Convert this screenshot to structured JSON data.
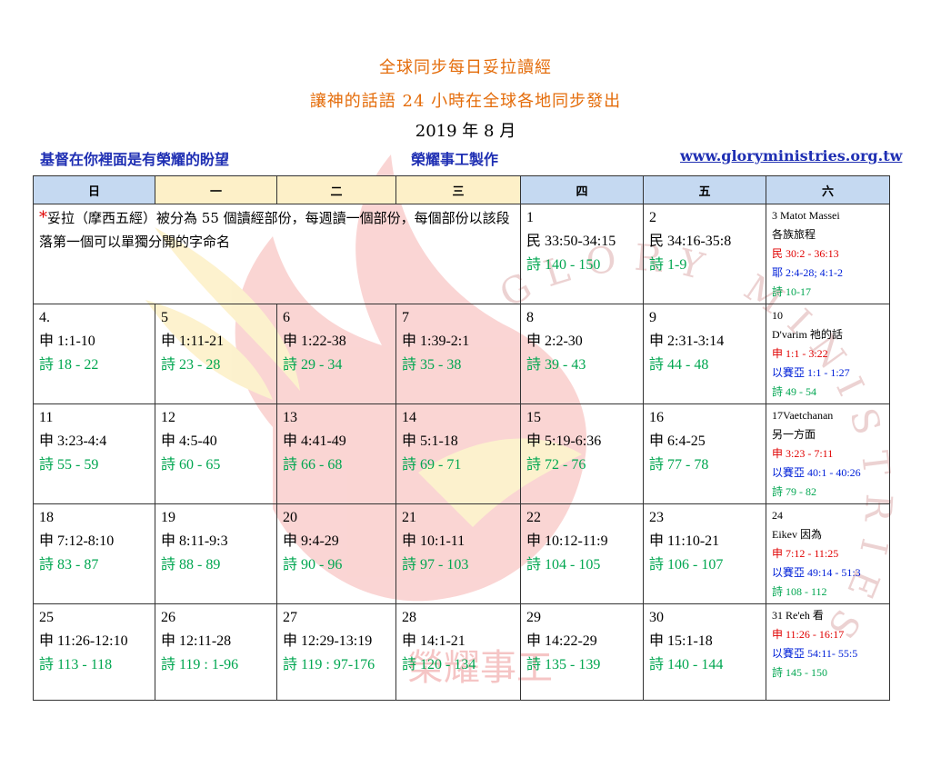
{
  "header": {
    "title": "全球同步每日妥拉讀經",
    "subtitle": "讓神的話語 24 小時在全球各地同步發出",
    "date": "2019 年 8 月",
    "motto": "基督在你裡面是有榮耀的盼望",
    "producer": "榮耀事工製作",
    "website": "www.gloryministries.org.tw"
  },
  "weekdays": [
    "日",
    "一",
    "二",
    "三",
    "四",
    "五",
    "六"
  ],
  "note": {
    "star": "*",
    "text": "妥拉（摩西五經）被分為 55 個讀經部份，每週讀一個部份，每個部份以該段落第一個可以單獨分開的字命名"
  },
  "watermark": {
    "arc_text": "GLORY MINISTRIES",
    "logo_text": "榮耀事工"
  },
  "weeks": [
    {
      "days": [
        {
          "num": "1",
          "reading": "民 33:50-34:15",
          "psalm": "詩  140 - 150"
        },
        {
          "num": "2",
          "reading": "民 34:16-35:8",
          "psalm": "詩  1-9"
        }
      ],
      "sabbath": {
        "line1": "3 Matot Massei",
        "line2": "各族旅程",
        "red": "民 30:2 - 36:13",
        "blue": "耶 2:4-28; 4:1-2",
        "green": "詩  10-17"
      }
    },
    {
      "days": [
        {
          "num": "4.",
          "reading": "申 1:1-10",
          "psalm": "詩  18 - 22"
        },
        {
          "num": "5",
          "reading": "申 1:11-21",
          "psalm": "詩  23 - 28"
        },
        {
          "num": "6",
          "reading": "申 1:22-38",
          "psalm": "詩  29 - 34"
        },
        {
          "num": "7",
          "reading": "申 1:39-2:1",
          "psalm": "詩  35 - 38"
        },
        {
          "num": "8",
          "reading": "申 2:2-30",
          "psalm": "詩  39 - 43"
        },
        {
          "num": "9",
          "reading": "申 2:31-3:14",
          "psalm": "詩  44 - 48"
        }
      ],
      "sabbath": {
        "line1": "10",
        "line2": "D'varim  祂的話",
        "red": "申 1:1 - 3:22",
        "blue": "以賽亞 1:1 - 1:27",
        "green": "詩  49 - 54"
      }
    },
    {
      "days": [
        {
          "num": "11",
          "reading": "申 3:23-4:4",
          "psalm": "詩  55 - 59"
        },
        {
          "num": "12",
          "reading": "申 4:5-40",
          "psalm": "詩  60 - 65"
        },
        {
          "num": "13",
          "reading": "申 4:41-49",
          "psalm": "詩  66 - 68"
        },
        {
          "num": "14",
          "reading": "申 5:1-18",
          "psalm": "詩  69 - 71"
        },
        {
          "num": "15",
          "reading": "申 5:19-6:36",
          "psalm": "詩  72 - 76"
        },
        {
          "num": "16",
          "reading": "申 6:4-25",
          "psalm": "詩  77 - 78"
        }
      ],
      "sabbath": {
        "line1": "17Vaetchanan",
        "line2": "另一方面",
        "red": "申 3:23 - 7:11",
        "blue": "以賽亞 40:1 - 40:26",
        "green": "詩  79 - 82"
      }
    },
    {
      "days": [
        {
          "num": "18",
          "reading": "申 7:12-8:10",
          "psalm": "詩  83 - 87"
        },
        {
          "num": "19",
          "reading": "申 8:11-9:3",
          "psalm": "詩  88 - 89"
        },
        {
          "num": "20",
          "reading": "申 9:4-29",
          "psalm": "詩  90 - 96"
        },
        {
          "num": "21",
          "reading": "申 10:1-11",
          "psalm": "詩  97 - 103"
        },
        {
          "num": "22",
          "reading": "申 10:12-11:9",
          "psalm": "詩  104 - 105"
        },
        {
          "num": "23",
          "reading": "申 11:10-21",
          "psalm": "詩  106 - 107"
        }
      ],
      "sabbath": {
        "line1": "24",
        "line2": "Eikev  因為",
        "red": "申 7:12 - 11:25",
        "blue": "以賽亞 49:14 - 51:3",
        "green": "詩  108 - 112"
      }
    },
    {
      "days": [
        {
          "num": "25",
          "reading": "申 11:26-12:10",
          "psalm": "詩  113 - 118"
        },
        {
          "num": "26",
          "reading": "申 12:11-28",
          "psalm": "詩  119 : 1-96"
        },
        {
          "num": "27",
          "reading": "申 12:29-13:19",
          "psalm": "詩 119 : 97-176"
        },
        {
          "num": "28",
          "reading": "申 14:1-21",
          "psalm": "詩 120 - 134"
        },
        {
          "num": "29",
          "reading": "申 14:22-29",
          "psalm": "詩 135 - 139"
        },
        {
          "num": "30",
          "reading": "申 15:1-18",
          "psalm": "詩  140 - 144"
        }
      ],
      "sabbath": {
        "line1": "31 Re'eh  看",
        "line2": "",
        "red": "申 11:26 - 16:17",
        "blue": "以賽亞 54:11- 55:5",
        "green": "詩  145 - 150"
      }
    }
  ]
}
